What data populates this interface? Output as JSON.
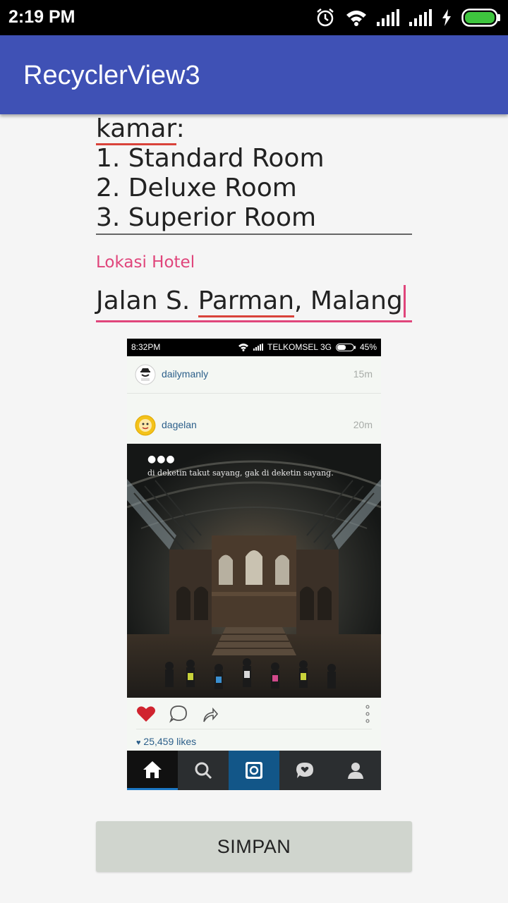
{
  "status_bar": {
    "time": "2:19 PM"
  },
  "app_bar": {
    "title": "RecyclerView3"
  },
  "form": {
    "room_field": {
      "line0_prefix": "kamar",
      "line0_suffix": ":",
      "line1": "1. Standard Room",
      "line2": "2. Deluxe Room",
      "line3": "3. Superior Room"
    },
    "location_field": {
      "label": "Lokasi Hotel",
      "value_part1": "Jalan S. ",
      "value_part2": "Parman",
      "value_part3": ", Malang"
    },
    "save_label": "SIMPAN"
  },
  "embedded_image": {
    "status_time": "8:32PM",
    "carrier": "TELKOMSEL 3G",
    "battery": "45%",
    "posts": [
      {
        "user": "dailymanly",
        "ago": "15m"
      },
      {
        "user": "dagelan",
        "ago": "20m"
      }
    ],
    "caption": "di deketin takut sayang, gak di deketin sayang.",
    "likes": "25,459 likes"
  },
  "colors": {
    "app_bar": "#3f51b5",
    "accent": "#e0457b",
    "button": "#d0d5ce"
  }
}
